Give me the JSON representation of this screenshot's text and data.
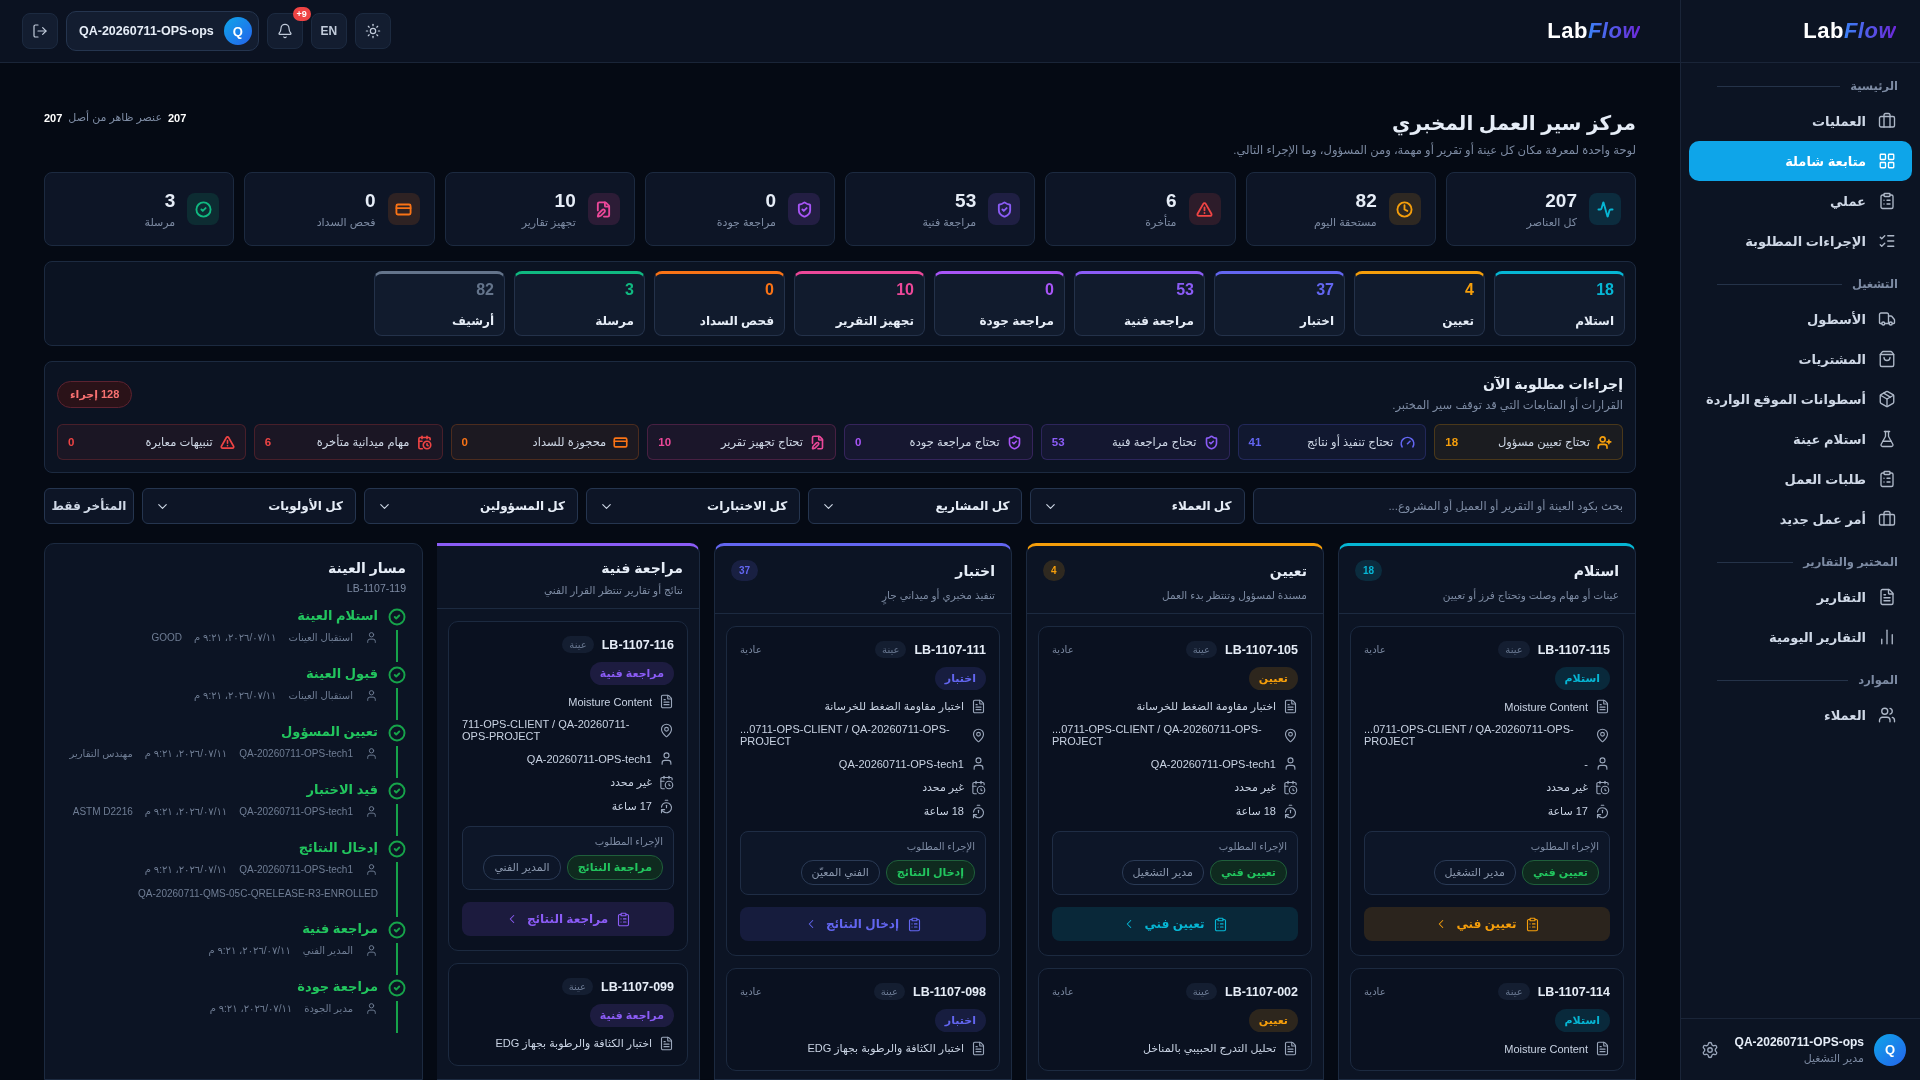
{
  "topbar": {
    "logo": {
      "first": "Lab",
      "second": "Flow"
    },
    "user": {
      "name": "QA-20260711-OPS-ops",
      "avatar": "Q"
    },
    "notifications": "+9",
    "language": "EN"
  },
  "sidebar": {
    "logo": {
      "first": "Lab",
      "second": "Flow"
    },
    "sections": [
      {
        "title": "الرئيسية",
        "items": [
          {
            "label": "العمليات",
            "selected": false
          },
          {
            "label": "متابعة شاملة",
            "selected": true
          },
          {
            "label": "عملي",
            "selected": false
          },
          {
            "label": "الإجراءات المطلوبة",
            "selected": false
          }
        ]
      },
      {
        "title": "التشغيل",
        "items": [
          {
            "label": "الأسطول",
            "selected": false
          },
          {
            "label": "المشتريات",
            "selected": false
          },
          {
            "label": "أسطوانات الموقع الواردة",
            "selected": false
          },
          {
            "label": "استلام عينة",
            "selected": false
          },
          {
            "label": "طلبات العمل",
            "selected": false
          },
          {
            "label": "أمر عمل جديد",
            "selected": false
          }
        ]
      },
      {
        "title": "المختبر والتقارير",
        "items": [
          {
            "label": "التقارير",
            "selected": false
          },
          {
            "label": "التقارير اليومية",
            "selected": false
          }
        ]
      },
      {
        "title": "الموارد",
        "items": [
          {
            "label": "العملاء",
            "selected": false
          }
        ]
      }
    ],
    "user": {
      "name": "QA-20260711-OPS-ops",
      "role": "مدير التشغيل",
      "avatar": "Q"
    }
  },
  "header": {
    "title": "مركز سير العمل المخبري",
    "subtitle": "لوحة واحدة لمعرفة مكان كل عينة أو تقرير أو مهمة، ومن المسؤول، وما الإجراء التالي.",
    "visible_count": "207",
    "visible_text": "عنصر ظاهر من أصل",
    "total_count": "207"
  },
  "stats": [
    {
      "label": "كل العناصر",
      "value": "207",
      "color": "#06b6d4"
    },
    {
      "label": "مستحقة اليوم",
      "value": "82",
      "color": "#f59e0b"
    },
    {
      "label": "متأخرة",
      "value": "6",
      "color": "#ef4444"
    },
    {
      "label": "مراجعة فنية",
      "value": "53",
      "color": "#8b5cf6"
    },
    {
      "label": "مراجعة جودة",
      "value": "0",
      "color": "#a855f7"
    },
    {
      "label": "تجهيز تقارير",
      "value": "10",
      "color": "#ec4899"
    },
    {
      "label": "فحص السداد",
      "value": "0",
      "color": "#f97316"
    },
    {
      "label": "مرسلة",
      "value": "3",
      "color": "#10b981"
    }
  ],
  "stages": [
    {
      "label": "استلام",
      "value": "18",
      "color": "#06b6d4"
    },
    {
      "label": "تعيين",
      "value": "4",
      "color": "#f59e0b"
    },
    {
      "label": "اختبار",
      "value": "37",
      "color": "#6366f1"
    },
    {
      "label": "مراجعة فنية",
      "value": "53",
      "color": "#8b5cf6"
    },
    {
      "label": "مراجعة جودة",
      "value": "0",
      "color": "#a855f7"
    },
    {
      "label": "تجهيز التقرير",
      "value": "10",
      "color": "#ec4899"
    },
    {
      "label": "فحص السداد",
      "value": "0",
      "color": "#f97316"
    },
    {
      "label": "مرسلة",
      "value": "3",
      "color": "#10b981"
    },
    {
      "label": "أرشيف",
      "value": "82",
      "color": "#64748b"
    }
  ],
  "actions": {
    "title": "إجراءات مطلوبة الآن",
    "subtitle": "القرارات أو المتابعات التي قد توقف سير المختبر.",
    "badge": "128 إجراء",
    "items": [
      {
        "label": "تحتاج تعيين مسؤول",
        "value": "18",
        "color": "#f59e0b"
      },
      {
        "label": "تحتاج تنفيذ أو نتائج",
        "value": "41",
        "color": "#6366f1"
      },
      {
        "label": "تحتاج مراجعة فنية",
        "value": "53",
        "color": "#8b5cf6"
      },
      {
        "label": "تحتاج مراجعة جودة",
        "value": "0",
        "color": "#a855f7"
      },
      {
        "label": "تحتاج تجهيز تقرير",
        "value": "10",
        "color": "#ec4899"
      },
      {
        "label": "محجوزة للسداد",
        "value": "0",
        "color": "#f97316"
      },
      {
        "label": "مهام ميدانية متأخرة",
        "value": "6",
        "color": "#ef4444"
      },
      {
        "label": "تنبيهات معايرة",
        "value": "0",
        "color": "#ef4444"
      }
    ]
  },
  "filters": {
    "search": {
      "placeholder": "بحث بكود العينة أو التقرير أو العميل أو المشروع..."
    },
    "selects": [
      "كل العملاء",
      "كل المشاريع",
      "كل الاختبارات",
      "كل المسؤولين",
      "كل الأولويات"
    ],
    "late_only": "المتأخر فقط"
  },
  "columns": [
    {
      "title": "استلام",
      "subtitle": "عينات أو مهام وصلت وتحتاج فرز أو تعيين",
      "count": "18",
      "color": "#06b6d4",
      "cards": [
        {
          "id": "LB-1107-115",
          "type": "عينة",
          "priority": "عادية",
          "status": "استلام",
          "test": "Moisture Content",
          "location": "...0711-OPS-CLIENT / QA-20260711-OPS-PROJECT",
          "assignee": "-",
          "due": "غير محدد",
          "age": "17 ساعة",
          "action_title": "الإجراء المطلوب",
          "action": "تعيين فني",
          "role": "مدير التشغيل",
          "button": {
            "label": "تعيين فني",
            "color": "#f59e0b"
          }
        },
        {
          "id": "LB-1107-114",
          "type": "عينة",
          "priority": "عادية",
          "status": "استلام",
          "test": "Moisture Content"
        }
      ]
    },
    {
      "title": "تعيين",
      "subtitle": "مسندة لمسؤول وتنتظر بدء العمل",
      "count": "4",
      "color": "#f59e0b",
      "cards": [
        {
          "id": "LB-1107-105",
          "type": "عينة",
          "priority": "عادية",
          "status": "تعيين",
          "test": "اختبار مقاومة الضغط للخرسانة",
          "location": "...0711-OPS-CLIENT / QA-20260711-OPS-PROJECT",
          "assignee": "QA-20260711-OPS-tech1",
          "due": "غير محدد",
          "age": "18 ساعة",
          "action_title": "الإجراء المطلوب",
          "action": "تعيين فني",
          "role": "مدير التشغيل",
          "button": {
            "label": "تعيين فني",
            "color": "#06b6d4"
          }
        },
        {
          "id": "LB-1107-002",
          "type": "عينة",
          "priority": "عادية",
          "status": "تعيين",
          "test": "تحليل التدرج الحبيبي بالمناخل"
        }
      ]
    },
    {
      "title": "اختبار",
      "subtitle": "تنفيذ مخبري أو ميداني جارٍ",
      "count": "37",
      "color": "#6366f1",
      "cards": [
        {
          "id": "LB-1107-111",
          "type": "عينة",
          "priority": "عادية",
          "status": "اختبار",
          "test": "اختبار مقاومة الضغط للخرسانة",
          "location": "...0711-OPS-CLIENT / QA-20260711-OPS-PROJECT",
          "assignee": "QA-20260711-OPS-tech1",
          "due": "غير محدد",
          "age": "18 ساعة",
          "action_title": "الإجراء المطلوب",
          "action": "إدخال النتائج",
          "role": "الفني المعيّن",
          "button": {
            "label": "إدخال النتائج",
            "color": "#6366f1"
          }
        },
        {
          "id": "LB-1107-098",
          "type": "عينة",
          "priority": "عادية",
          "status": "اختبار",
          "test": "اختبار الكثافة والرطوبة بجهاز EDG"
        }
      ]
    },
    {
      "title": "مراجعة فنية",
      "subtitle": "نتائج أو تقارير تنتظر القرار الفني",
      "color": "#8b5cf6",
      "cards": [
        {
          "id": "LB-1107-116",
          "type": "عينة",
          "status": "مراجعة فنية",
          "test": "Moisture Content",
          "location": "711-OPS-CLIENT / QA-20260711-OPS-PROJECT",
          "assignee": "QA-20260711-OPS-tech1",
          "due": "غير محدد",
          "age": "17 ساعة",
          "action_title": "الإجراء المطلوب",
          "action": "مراجعة النتائج",
          "role": "المدير الفني",
          "button": {
            "label": "مراجعة النتائج",
            "color": "#8b5cf6"
          }
        },
        {
          "id": "LB-1107-099",
          "type": "عينة",
          "status": "مراجعة فنية",
          "test": "اختبار الكثافة والرطوبة بجهاز EDG"
        }
      ]
    }
  ],
  "sample_path": {
    "title": "مسار العينة",
    "id": "LB-1107-119",
    "steps": [
      {
        "title": "استلام العينة",
        "done": true,
        "meta": [
          "استقبال العينات",
          "٢٠٢٦/٠٧/١١، ٩:٢١ م",
          "GOOD"
        ]
      },
      {
        "title": "قبول العينة",
        "done": true,
        "meta": [
          "استقبال العينات",
          "٢٠٢٦/٠٧/١١، ٩:٢١ م"
        ]
      },
      {
        "title": "تعيين المسؤول",
        "done": true,
        "meta": [
          "QA-20260711-OPS-tech1",
          "٢٠٢٦/٠٧/١١، ٩:٢١ م",
          "مهندس التقارير"
        ]
      },
      {
        "title": "قيد الاختبار",
        "done": true,
        "meta": [
          "QA-20260711-OPS-tech1",
          "٢٠٢٦/٠٧/١١، ٩:٢١ م",
          "ASTM D2216"
        ]
      },
      {
        "title": "إدخال النتائج",
        "done": true,
        "meta": [
          "QA-20260711-OPS-tech1",
          "٢٠٢٦/٠٧/١١، ٩:٢١ م"
        ],
        "note": "QA-20260711-QMS-05C-QRELEASE-R3-ENROLLED"
      },
      {
        "title": "مراجعة فنية",
        "done": true,
        "meta": [
          "المدير الفني",
          "٢٠٢٦/٠٧/١١، ٩:٢١ م"
        ]
      },
      {
        "title": "مراجعة جودة",
        "done": true,
        "meta": [
          "مدير الجودة",
          "٢٠٢٦/٠٧/١١، ٩:٢١ م"
        ]
      }
    ]
  }
}
